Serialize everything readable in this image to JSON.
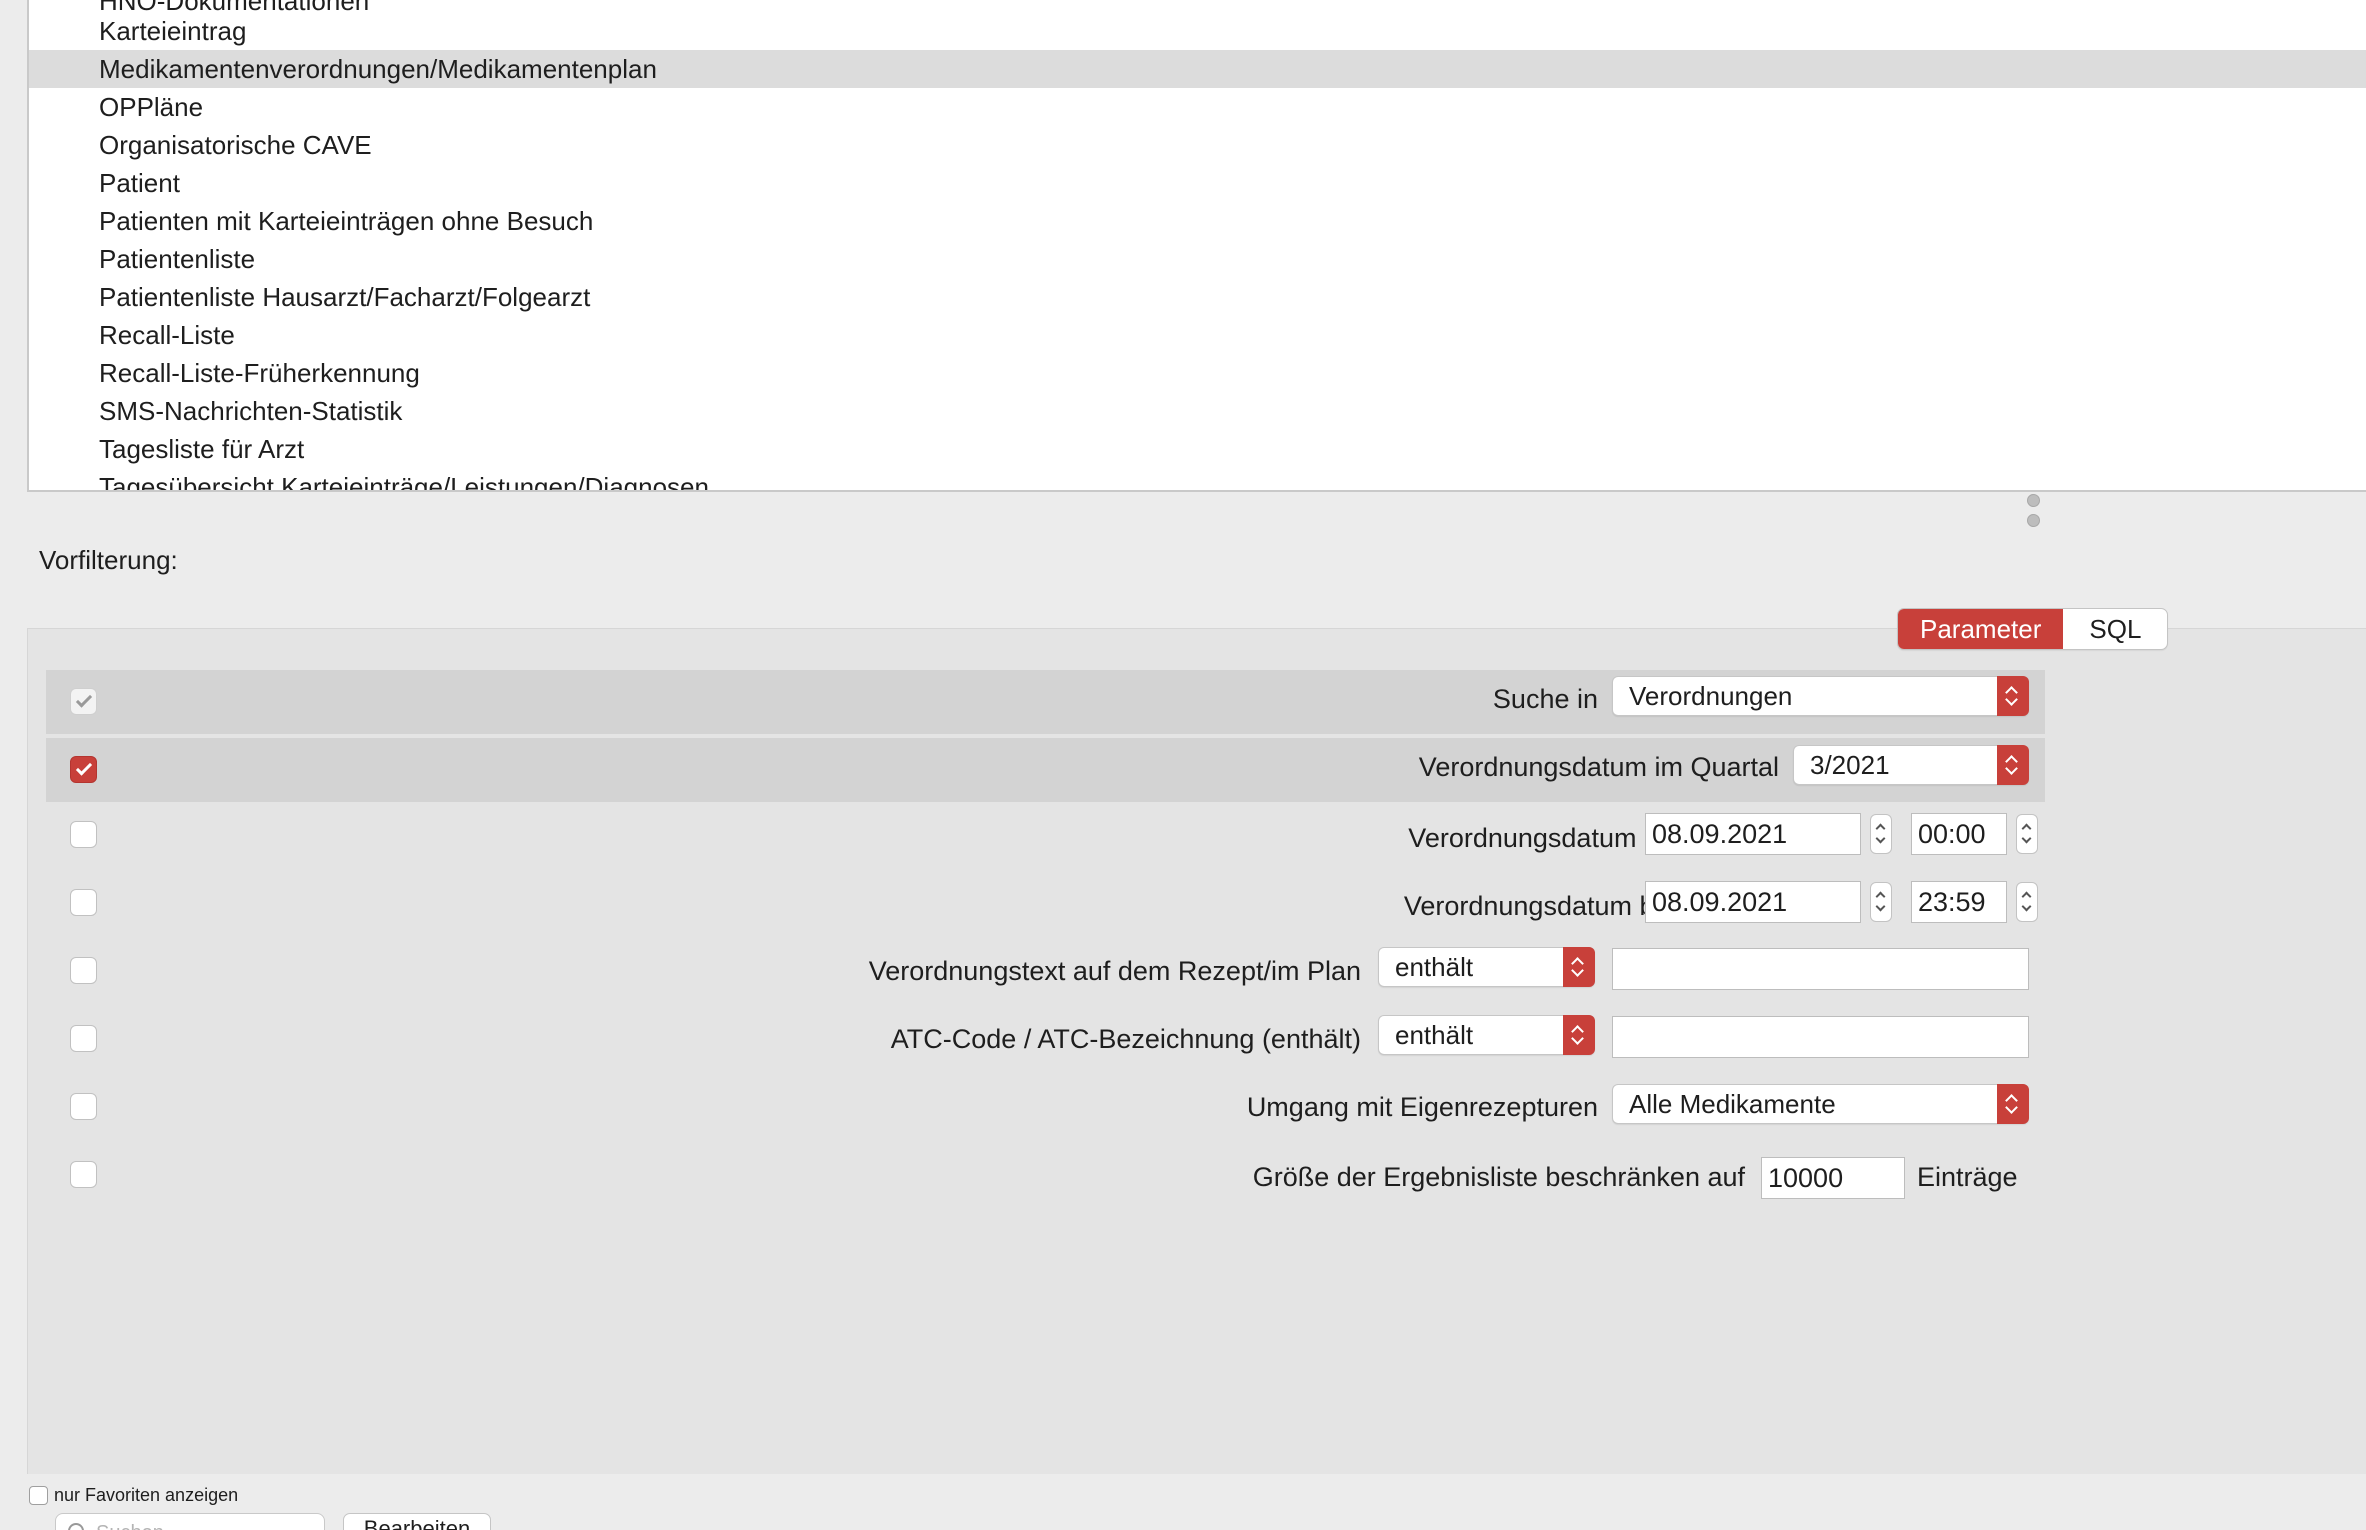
{
  "report_list": {
    "items": [
      "HNO-Dokumentationen",
      "Karteieintrag",
      "Medikamentenverordnungen/Medikamentenplan",
      "OPPläne",
      "Organisatorische CAVE",
      "Patient",
      "Patienten mit Karteieinträgen ohne Besuch",
      "Patientenliste",
      "Patientenliste Hausarzt/Facharzt/Folgearzt",
      "Recall-Liste",
      "Recall-Liste-Früherkennung",
      "SMS-Nachrichten-Statistik",
      "Tagesliste für Arzt",
      "Tagesübersicht Karteieinträge/Leistungen/Diagnosen"
    ],
    "selected_index": 2
  },
  "prefilter": {
    "label": "Vorfilterung:",
    "tabs": {
      "parameter": "Parameter",
      "sql": "SQL",
      "active": "Parameter"
    },
    "rows": [
      {
        "checked": true,
        "disabled": true,
        "label": "Suche in",
        "select_value": "Verordnungen"
      },
      {
        "checked": true,
        "label": "Verordnungsdatum im Quartal",
        "select_value": "3/2021"
      },
      {
        "checked": false,
        "label": "Verordnungsdatum ab",
        "date": "08.09.2021",
        "time": "00:00"
      },
      {
        "checked": false,
        "label": "Verordnungsdatum bis",
        "date": "08.09.2021",
        "time": "23:59"
      },
      {
        "checked": false,
        "label": "Verordnungstext auf dem Rezept/im Plan",
        "operator": "enthält",
        "text": ""
      },
      {
        "checked": false,
        "label": "ATC-Code / ATC-Bezeichnung (enthält)",
        "operator": "enthält",
        "text": ""
      },
      {
        "checked": false,
        "label": "Umgang mit Eigenrezepturen",
        "select_value": "Alle Medikamente"
      },
      {
        "checked": false,
        "label": "Größe der Ergebnisliste beschränken auf",
        "limit": "10000",
        "suffix": "Einträge"
      }
    ]
  },
  "bottom": {
    "favorites_label": "nur Favoriten anzeigen",
    "favorites_checked": false,
    "search_placeholder": "Suchen",
    "edit_button": "Bearbeiten"
  },
  "colors": {
    "accent": "#c8403a",
    "selection": "#dcdcdc",
    "panel": "#e4e4e4"
  }
}
